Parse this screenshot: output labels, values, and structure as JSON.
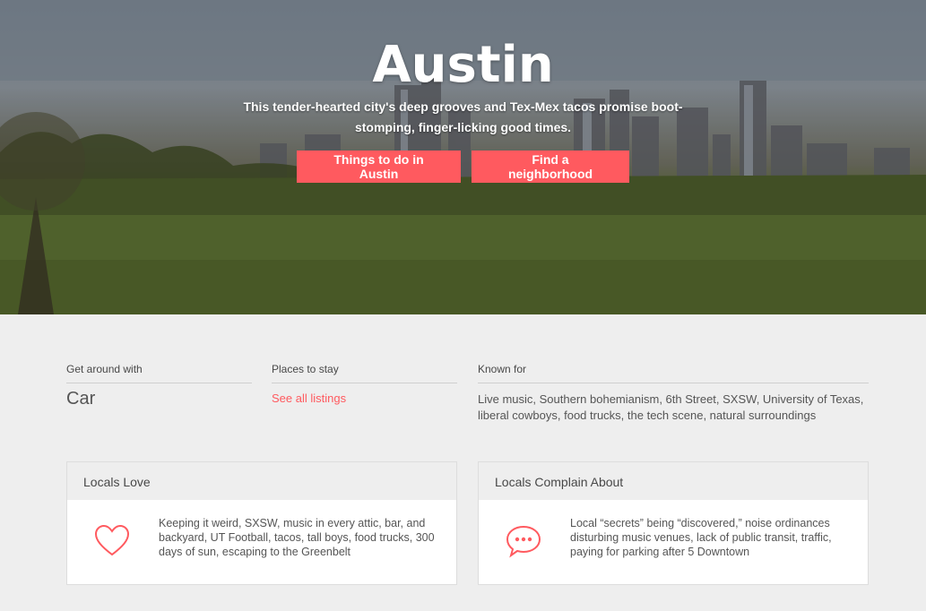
{
  "hero": {
    "title": "Austin",
    "subtitle": "This tender-hearted city's deep grooves and Tex-Mex tacos promise boot-stomping, finger-licking good times.",
    "buttons": {
      "things_to_do": "Things to do in Austin",
      "find_neighborhood": "Find a neighborhood"
    }
  },
  "facts": {
    "get_around": {
      "label": "Get around with",
      "value": "Car"
    },
    "places_to_stay": {
      "label": "Places to stay",
      "link": "See all listings"
    },
    "known_for": {
      "label": "Known for",
      "value": "Live music, Southern bohemianism, 6th Street, SXSW, University of Texas, liberal cowboys, food trucks, the tech scene, natural surroundings"
    }
  },
  "cards": {
    "locals_love": {
      "title": "Locals Love",
      "icon": "heart-icon",
      "text": "Keeping it weird, SXSW, music in every attic, bar, and backyard, UT Football, tacos, tall boys, food trucks, 300 days of sun, escaping to the Greenbelt"
    },
    "locals_complain": {
      "title": "Locals Complain About",
      "icon": "chat-bubble-icon",
      "text": "Local “secrets” being “discovered,” noise ordinances disturbing music venues, lack of public transit, traffic, paying for parking after 5 Downtown"
    }
  },
  "colors": {
    "accent": "#ff5a5f",
    "background": "#eeeeee"
  }
}
